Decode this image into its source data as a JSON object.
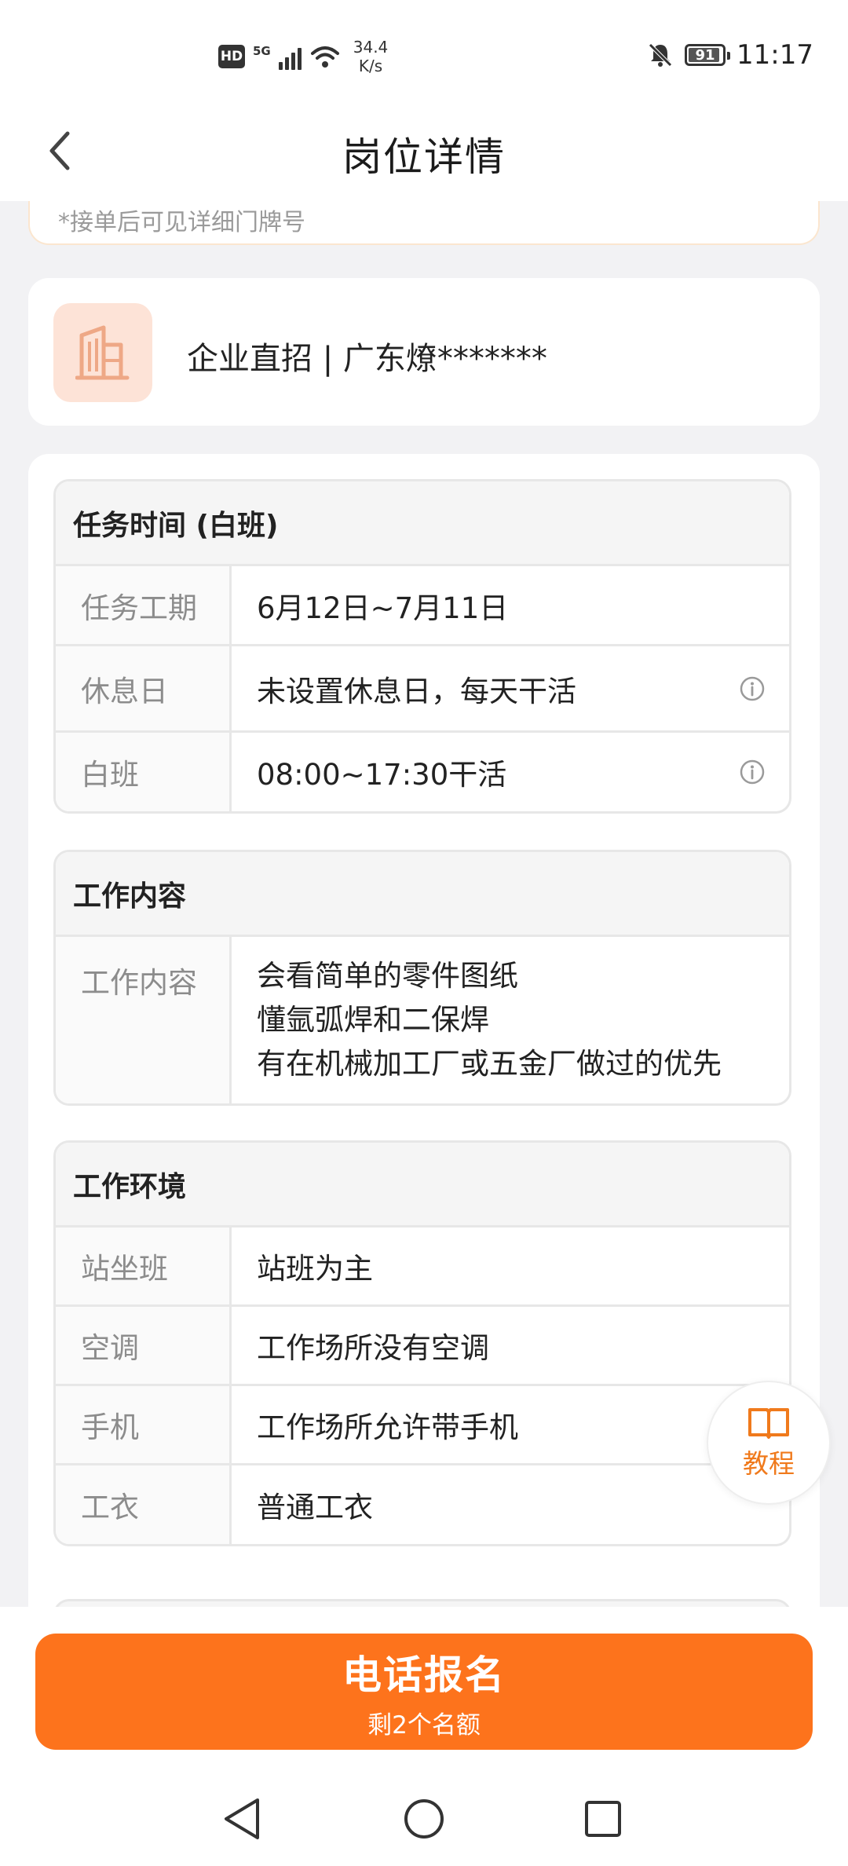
{
  "status_bar": {
    "hd": "HD",
    "network": "5G",
    "speed_value": "34.4",
    "speed_unit": "K/s",
    "battery": "91",
    "time": "11:17"
  },
  "header": {
    "title": "岗位详情"
  },
  "prev_card": {
    "text": "*接单后可见详细门牌号"
  },
  "company": {
    "name": "企业直招 | 广东燎*******"
  },
  "task_time": {
    "title": "任务时间 (白班)",
    "rows": [
      {
        "key": "任务工期",
        "value": "6月12日~7月11日"
      },
      {
        "key": "休息日",
        "value": "未设置休息日，每天干活"
      },
      {
        "key": "白班",
        "value": "08:00~17:30干活"
      }
    ]
  },
  "work_content": {
    "title": "工作内容",
    "key": "工作内容",
    "lines": [
      "会看简单的零件图纸",
      "懂氩弧焊和二保焊",
      "有在机械加工厂或五金厂做过的优先"
    ]
  },
  "work_env": {
    "title": "工作环境",
    "rows": [
      {
        "key": "站坐班",
        "value": "站班为主"
      },
      {
        "key": "空调",
        "value": "工作场所没有空调"
      },
      {
        "key": "手机",
        "value": "工作场所允许带手机"
      },
      {
        "key": "工衣",
        "value": "普通工衣"
      }
    ]
  },
  "tutorial": {
    "label": "教程"
  },
  "cta": {
    "label": "电话报名",
    "sub": "剩2个名额"
  },
  "colors": {
    "accent": "#fd731c",
    "tutorial": "#f07a1c",
    "logo_bg": "#fde3d7"
  }
}
